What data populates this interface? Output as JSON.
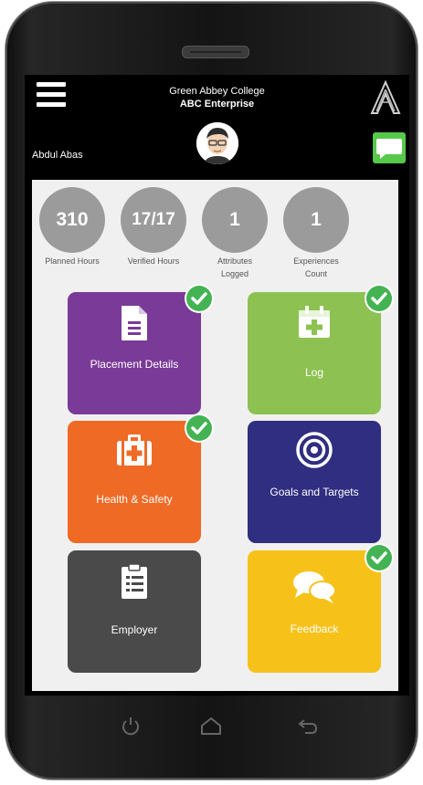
{
  "header": {
    "org_line1": "Green Abbey College",
    "org_line2": "ABC Enterprise",
    "user_name": "Abdul Abas"
  },
  "stats": [
    {
      "value": "310",
      "label": "Planned Hours"
    },
    {
      "value": "17/17",
      "label": "Verified Hours"
    },
    {
      "value": "1",
      "label": "Attributes Logged"
    },
    {
      "value": "1",
      "label": "Experiences Count"
    }
  ],
  "tiles": [
    {
      "label": "Placement Details",
      "icon": "document-icon",
      "color": "#7a3a97",
      "completed": true
    },
    {
      "label": "Log",
      "icon": "calendar-plus-icon",
      "color": "#8dc252",
      "completed": true
    },
    {
      "label": "Health & Safety",
      "icon": "first-aid-kit-icon",
      "color": "#ef6a25",
      "completed": true
    },
    {
      "label": "Goals and Targets",
      "icon": "target-icon",
      "color": "#2f2e80",
      "completed": false
    },
    {
      "label": "Employer",
      "icon": "clipboard-list-icon",
      "color": "#4a4a4a",
      "completed": false
    },
    {
      "label": "Feedback",
      "icon": "speech-bubbles-icon",
      "color": "#f6c21a",
      "completed": true
    }
  ],
  "colors": {
    "check_green": "#44b353",
    "chat_green": "#57c94a",
    "stat_grey": "#9b9b9b"
  }
}
